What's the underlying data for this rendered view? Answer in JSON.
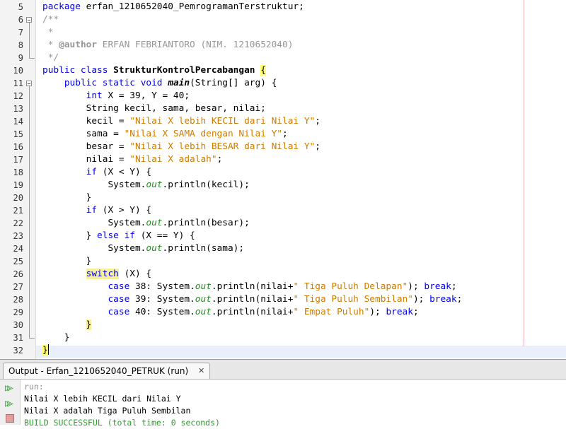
{
  "editor": {
    "lines": [
      {
        "n": "5",
        "html": "<span class='k'>package</span> erfan_1210652040_PemrogramanTerstruktur;"
      },
      {
        "n": "6",
        "html": "<span class='c'>/**</span>"
      },
      {
        "n": "7",
        "html": "<span class='c'> *</span>"
      },
      {
        "n": "8",
        "html": "<span class='c'> * </span><span class='cb'>@author</span><span class='c'> ERFAN FEBRIANTORO (NIM. 1210652040)</span>"
      },
      {
        "n": "9",
        "html": "<span class='c'> */</span>"
      },
      {
        "n": "10",
        "html": "<span class='k'>public class</span> <span class='b'>StrukturKontrolPercabangan</span> <span class='hl'>{</span>"
      },
      {
        "n": "11",
        "html": "    <span class='k'>public static void</span> <span class='bi'>main</span>(String[] arg) {"
      },
      {
        "n": "12",
        "html": "        <span class='k'>int</span> X = 39, Y = 40;"
      },
      {
        "n": "13",
        "html": "        String kecil, sama, besar, nilai;"
      },
      {
        "n": "14",
        "html": "        kecil = <span class='s'>\"Nilai X lebih KECIL dari Nilai Y\"</span>;"
      },
      {
        "n": "15",
        "html": "        sama = <span class='s'>\"Nilai X SAMA dengan Nilai Y\"</span>;"
      },
      {
        "n": "16",
        "html": "        besar = <span class='s'>\"Nilai X lebih BESAR dari Nilai Y\"</span>;"
      },
      {
        "n": "17",
        "html": "        nilai = <span class='s'>\"Nilai X adalah\"</span>;"
      },
      {
        "n": "18",
        "html": "        <span class='k'>if</span> (X &lt; Y) {"
      },
      {
        "n": "19",
        "html": "            System.<span class='f'>out</span>.println(kecil);"
      },
      {
        "n": "20",
        "html": "        }"
      },
      {
        "n": "21",
        "html": "        <span class='k'>if</span> (X &gt; Y) {"
      },
      {
        "n": "22",
        "html": "            System.<span class='f'>out</span>.println(besar);"
      },
      {
        "n": "23",
        "html": "        } <span class='k'>else if</span> (X == Y) {"
      },
      {
        "n": "24",
        "html": "            System.<span class='f'>out</span>.println(sama);"
      },
      {
        "n": "25",
        "html": "        }"
      },
      {
        "n": "26",
        "html": "        <span class='k sw'>switch</span> (X) {"
      },
      {
        "n": "27",
        "html": "            <span class='k'>case</span> 38: System.<span class='f'>out</span>.println(nilai+<span class='s'>\" Tiga Puluh Delapan\"</span>); <span class='k'>break</span>;"
      },
      {
        "n": "28",
        "html": "            <span class='k'>case</span> 39: System.<span class='f'>out</span>.println(nilai+<span class='s'>\" Tiga Puluh Sembilan\"</span>); <span class='k'>break</span>;"
      },
      {
        "n": "29",
        "html": "            <span class='k'>case</span> 40: System.<span class='f'>out</span>.println(nilai+<span class='s'>\" Empat Puluh\"</span>); <span class='k'>break</span>;"
      },
      {
        "n": "30",
        "html": "        <span class='sw'>}</span>"
      },
      {
        "n": "31",
        "html": "    }"
      },
      {
        "n": "32",
        "html": "<span class='hl'>}</span><span class='caret'></span>"
      }
    ]
  },
  "output": {
    "tab_label": "Output - Erfan_1210652040_PETRUK (run)",
    "close_glyph": "✕",
    "rerun_icon": "rerun-icon",
    "stop_icon": "stop-icon",
    "lines": [
      {
        "text": "run:",
        "kind": "run"
      },
      {
        "text": "Nilai X lebih KECIL dari Nilai Y",
        "kind": "plain"
      },
      {
        "text": "Nilai X adalah Tiga Puluh Sembilan",
        "kind": "plain"
      },
      {
        "text": "BUILD SUCCESSFUL (total time: 0 seconds)",
        "kind": "ok"
      }
    ]
  }
}
